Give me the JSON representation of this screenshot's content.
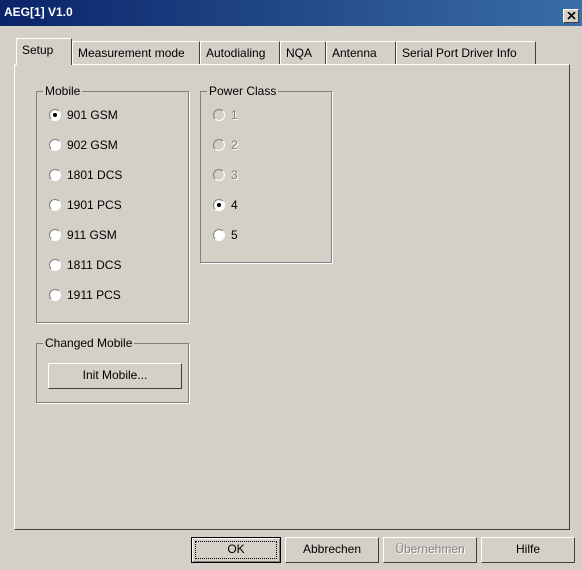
{
  "window": {
    "title": "AEG[1] V1.0"
  },
  "tabs": [
    "Setup",
    "Measurement mode",
    "Autodialing",
    "NQA",
    "Antenna",
    "Serial Port Driver Info"
  ],
  "mobile": {
    "legend": "Mobile",
    "options": [
      "901 GSM",
      "902 GSM",
      "1801 DCS",
      "1901 PCS",
      "911 GSM",
      "1811 DCS",
      "1911 PCS"
    ],
    "selected": "901 GSM"
  },
  "power_class": {
    "legend": "Power Class",
    "options": [
      "1",
      "2",
      "3",
      "4",
      "5"
    ],
    "disabled": [
      "1",
      "2",
      "3"
    ],
    "selected": "4"
  },
  "changed_mobile": {
    "legend": "Changed Mobile",
    "button": "Init Mobile..."
  },
  "buttons": {
    "ok": "OK",
    "cancel": "Abbrechen",
    "apply": "Übernehmen",
    "help": "Hilfe"
  }
}
